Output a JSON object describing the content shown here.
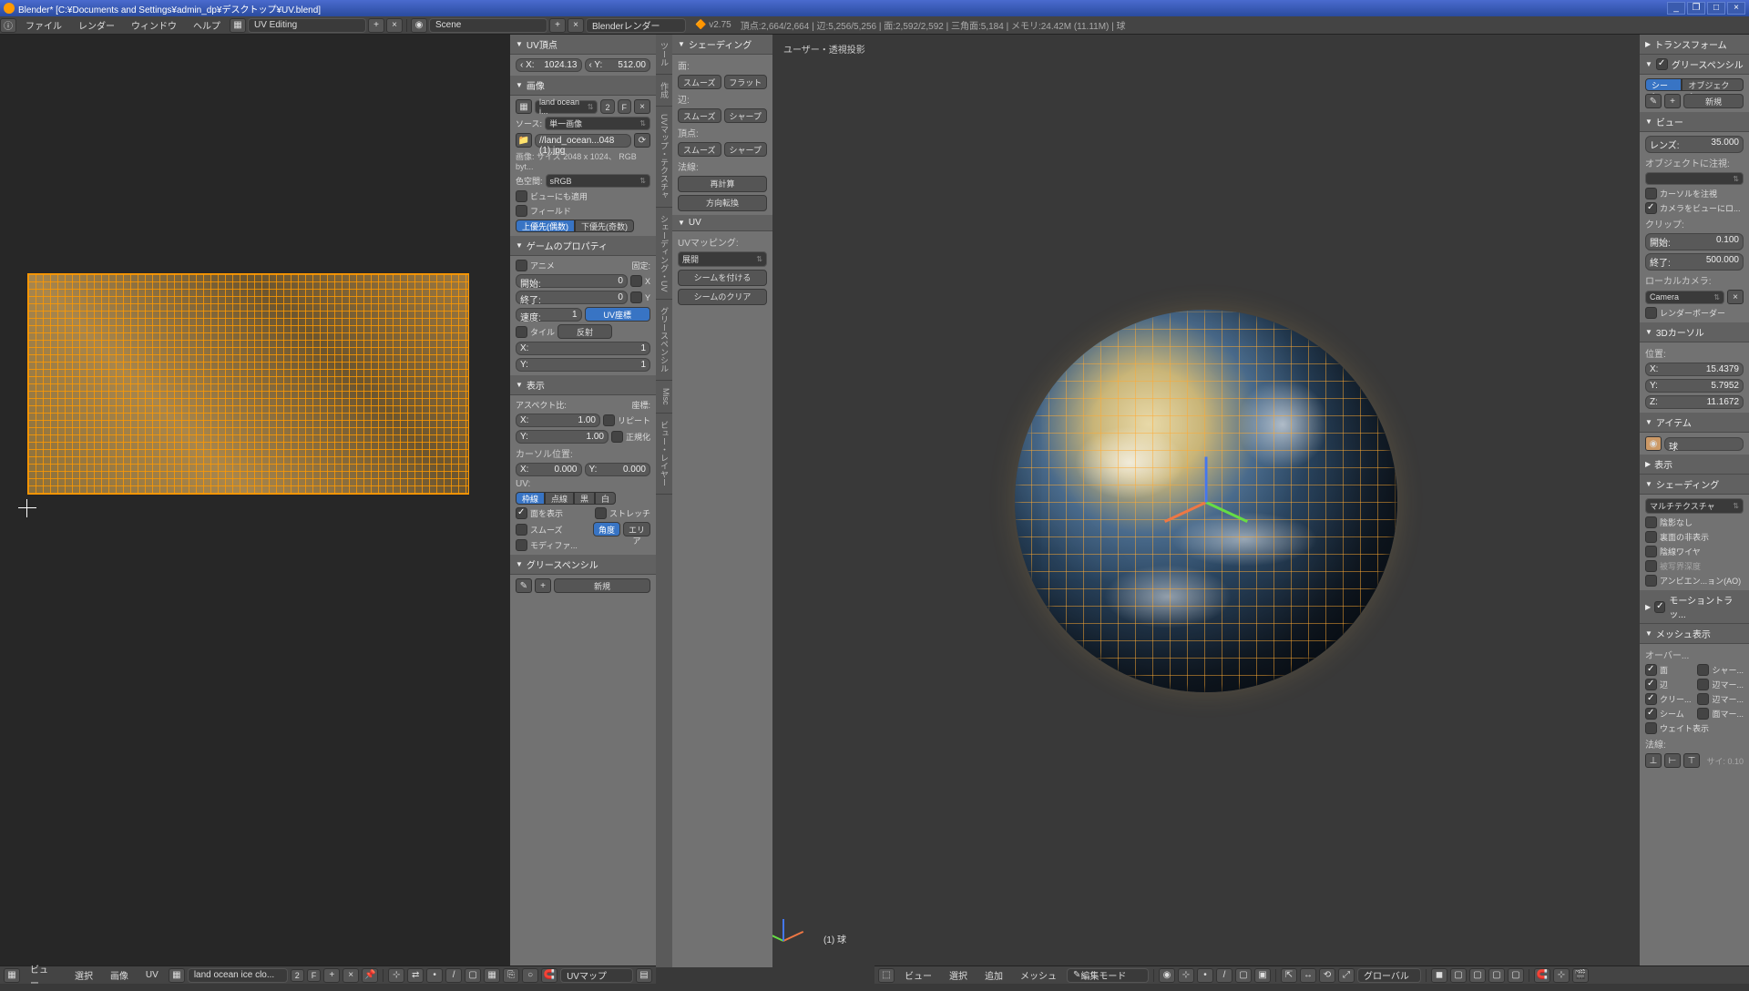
{
  "title": "Blender* [C:¥Documents and Settings¥admin_dp¥デスクトップ¥UV.blend]",
  "menus": {
    "info": "ⓘ",
    "file": "ファイル",
    "render": "レンダー",
    "window": "ウィンドウ",
    "help": "ヘルプ"
  },
  "layout": "UV Editing",
  "scene_label": "Scene",
  "engine": "Blenderレンダー",
  "version": "v2.75",
  "stats": "頂点:2,664/2,664 | 辺:5,256/5,256 | 面:2,592/2,592 | 三角面:5,184 | メモリ:24.42M (11.11M) | 球",
  "uv_panel": {
    "vertex_head": "UV頂点",
    "x": "1024.13",
    "y": "512.00",
    "image_head": "画像",
    "image_name": "land ocean i...",
    "users": "2",
    "fake": "F",
    "source_lbl": "ソース:",
    "source": "単一画像",
    "filepath": "//land_ocean...048 (1).jpg",
    "info": "画像: サイズ 2048 x 1024、 RGB byt...",
    "colorspace_lbl": "色空間:",
    "colorspace": "sRGB",
    "view_as": "ビューにも適用",
    "fields": "フィールド",
    "upper": "上優先(偶数)",
    "lower": "下優先(奇数)",
    "game_head": "ゲームのプロパティ",
    "anime": "アニメ",
    "fixed": "固定:",
    "start": "開始:",
    "start_v": "0",
    "end": "終了:",
    "end_v": "0",
    "speed": "速度:",
    "speed_v": "1",
    "cx": "X",
    "cy": "Y",
    "tile": "タイル",
    "tx_v": "1",
    "ty_v": "1",
    "uv_coord": "UV座標",
    "reflect": "反射",
    "display_head": "表示",
    "aspect": "アスペクト比:",
    "coord": "座標:",
    "ax": "1.00",
    "ay": "1.00",
    "repeat": "リピート",
    "normalize": "正規化",
    "cursor": "カーソル位置:",
    "cur_x": "0.000",
    "cur_y": "0.000",
    "uv_lbl": "UV:",
    "outline": "枠線",
    "dash": "点線",
    "black": "黒",
    "white": "白",
    "show_faces": "面を表示",
    "stretch": "ストレッチ",
    "smooth": "スムーズ",
    "angle": "角度",
    "area": "エリア",
    "modified": "モディファ...",
    "gp_head": "グリースペンシル",
    "new": "新規"
  },
  "tool_panel": {
    "shading_head": "シェーディング",
    "faces": "面:",
    "smooth": "スムーズ",
    "flat": "フラット",
    "edges": "辺:",
    "e_smooth": "スムーズ",
    "e_sharp": "シャープ",
    "verts": "頂点:",
    "v_smooth": "スムーズ",
    "v_sharp": "シャープ",
    "normals": "法線:",
    "recalc": "再計算",
    "flip": "方向転換",
    "uv_head": "UV",
    "uv_map": "UVマッピング:",
    "unwrap": "展開",
    "mark_seam": "シームを付ける",
    "clear_seam": "シームのクリア"
  },
  "tabs": [
    "ツール",
    "作成",
    "UVマップ・テクスチャ",
    "シェーディング・UV",
    "グリースペンシル",
    "Misc",
    "ビュー・レイヤー"
  ],
  "vp": {
    "header": "ユーザー・透視投影",
    "obj": "(1) 球"
  },
  "right": {
    "transform": "トランスフォーム",
    "gp": "グリースペンシル",
    "scene": "シーン",
    "object": "オブジェクト",
    "new": "新規",
    "view": "ビュー",
    "lens": "レンズ:",
    "lens_v": "35.000",
    "lock": "オブジェクトに注視:",
    "lock_cursor": "カーソルを注視",
    "cam_to_view": "カメラをビューにロ...",
    "clip": "クリップ:",
    "clip_start": "開始:",
    "clip_start_v": "0.100",
    "clip_end": "終了:",
    "clip_end_v": "500.000",
    "local_cam": "ローカルカメラ:",
    "camera": "Camera",
    "render_border": "レンダーボーダー",
    "cursor3d": "3Dカーソル",
    "pos": "位置:",
    "cx": "15.4379",
    "cy": "5.7952",
    "cz": "11.1672",
    "item": "アイテム",
    "item_name": "球",
    "display": "表示",
    "shading": "シェーディング",
    "shade_mode": "マルチテクスチャ",
    "no_shadow": "陰影なし",
    "backface": "裏面の非表示",
    "wire": "陰線ワイヤ",
    "depth": "被写界深度",
    "ao": "アンビエン...ョン(AO)",
    "motion": "モーショントラッ...",
    "mesh_disp": "メッシュ表示",
    "overlay": "オーバー...",
    "face": "面",
    "sharp": "シャー...",
    "edge": "辺",
    "bevel": "辺マー...",
    "crease": "クリー...",
    "edge_mark": "辺マー...",
    "seam": "シーム",
    "face_mark": "面マー...",
    "weight": "ウェイト表示",
    "normals_h": "法線:",
    "size": "サイ: 0.10"
  },
  "footer_uv": {
    "view": "ビュー",
    "select": "選択",
    "image": "画像",
    "uvs": "UV",
    "img_name": "land ocean ice clo...",
    "users": "2",
    "fake": "F",
    "uvmap": "UVマップ"
  },
  "footer_3d": {
    "view": "ビュー",
    "select": "選択",
    "add": "追加",
    "mesh": "メッシュ",
    "mode": "編集モード",
    "orient": "グローバル"
  }
}
